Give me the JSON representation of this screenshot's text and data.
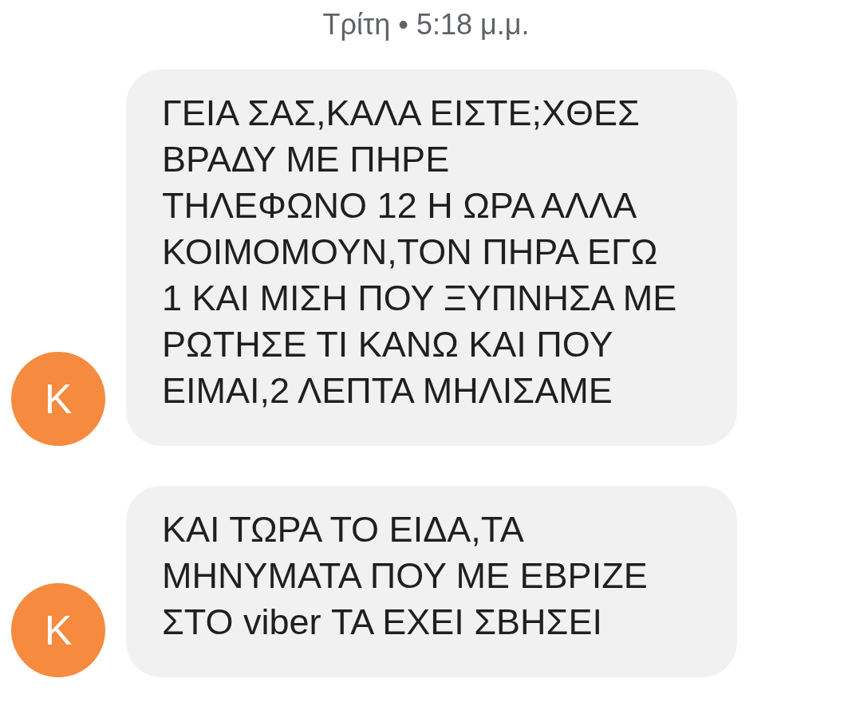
{
  "timestamp": "Τρίτη • 5:18 μ.μ.",
  "messages": [
    {
      "avatar": "K",
      "color": "#f68a3e",
      "lines": [
        "ΓΕΙΑ ΣΑΣ,ΚΑΛΑ ΕΙΣΤΕ;ΧΘΕΣ",
        "ΒΡΑΔΥ ΜΕ ΠΗΡΕ",
        "ΤΗΛΕΦΩΝΟ 12 Η ΩΡΑ ΑΛΛΑ",
        "ΚΟΙΜΟΜΟΥΝ,ΤΟΝ ΠΗΡΑ ΕΓΩ",
        "1 ΚΑΙ ΜΙΣΗ ΠΟΥ ΞΥΠΝΗΣΑ ΜΕ",
        "ΡΩΤΗΣΕ ΤΙ ΚΑΝΩ ΚΑΙ ΠΟΥ",
        "ΕΙΜΑΙ,2 ΛΕΠΤΑ ΜΗΛΙΣΑΜΕ"
      ]
    },
    {
      "avatar": "K",
      "color": "#f68a3e",
      "lines": [
        "ΚΑΙ ΤΩΡΑ ΤΟ ΕΙΔΑ,ΤΑ",
        "ΜΗΝΥΜΑΤΑ ΠΟΥ ΜΕ ΕΒΡΙΖΕ",
        "ΣΤΟ viber ΤΑ ΕΧΕΙ ΣΒΗΣΕΙ"
      ]
    }
  ]
}
